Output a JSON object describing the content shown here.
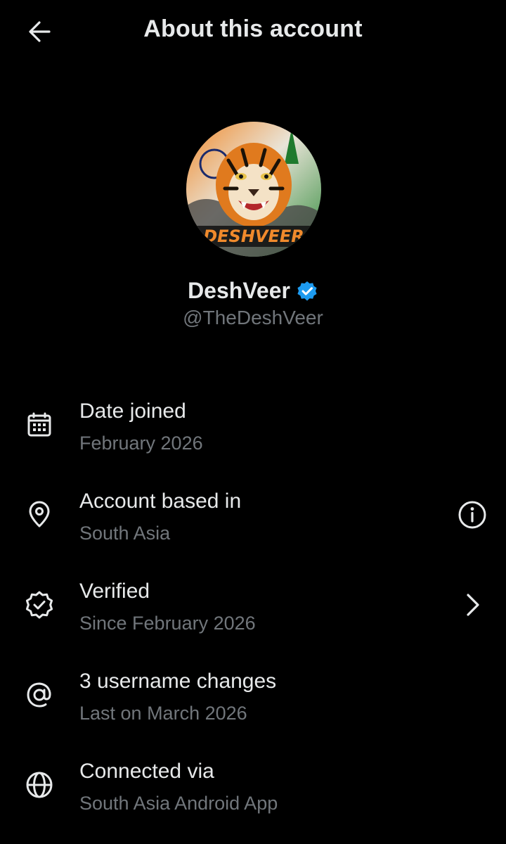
{
  "header": {
    "title": "About this account",
    "back_icon": "arrow-left-icon"
  },
  "profile": {
    "display_name": "DeshVeer",
    "handle": "@TheDeshVeer",
    "verified_color": "#1d9bf0",
    "avatar_text": "DESHVEER"
  },
  "items": [
    {
      "icon": "calendar-icon",
      "title": "Date joined",
      "subtitle": "February 2026"
    },
    {
      "icon": "location-pin-icon",
      "title": "Account based in",
      "subtitle": "South Asia",
      "trailing": "info-icon"
    },
    {
      "icon": "verified-badge-icon",
      "title": "Verified",
      "subtitle": "Since February 2026",
      "trailing": "chevron-right-icon"
    },
    {
      "icon": "at-sign-icon",
      "title": "3 username changes",
      "subtitle": "Last on March 2026"
    },
    {
      "icon": "globe-icon",
      "title": "Connected via",
      "subtitle": "South Asia Android App"
    }
  ],
  "colors": {
    "background": "#000000",
    "primary_text": "#e7e9ea",
    "secondary_text": "#71767b",
    "accent": "#1d9bf0"
  }
}
